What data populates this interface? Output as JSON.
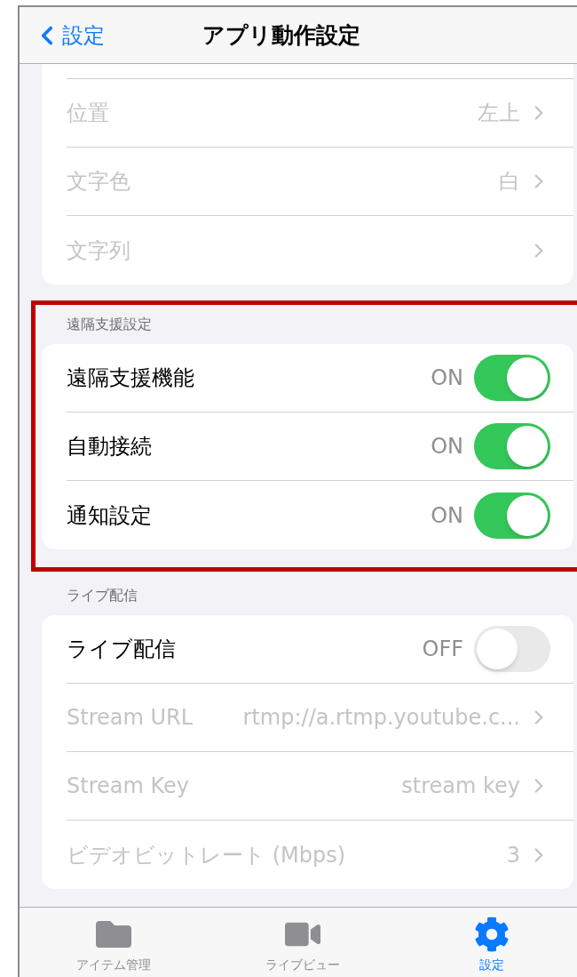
{
  "nav": {
    "back": "設定",
    "title": "アプリ動作設定"
  },
  "sections": [
    {
      "highlighted": false,
      "rows": [
        {
          "kind": "link",
          "label": "位置",
          "value": "左上",
          "disabled": true
        },
        {
          "kind": "link",
          "label": "文字色",
          "value": "白",
          "disabled": true
        },
        {
          "kind": "link",
          "label": "文字列",
          "disabled": true
        }
      ]
    },
    {
      "header": "遠隔支援設定",
      "highlighted": true,
      "rows": [
        {
          "kind": "toggle",
          "label": "遠隔支援機能",
          "value": "ON",
          "on": true,
          "disabled": false
        },
        {
          "kind": "toggle",
          "label": "自動接続",
          "value": "ON",
          "on": true,
          "disabled": false
        },
        {
          "kind": "toggle",
          "label": "通知設定",
          "value": "ON",
          "on": true,
          "disabled": false
        }
      ]
    },
    {
      "header": "ライブ配信",
      "highlighted": false,
      "rows": [
        {
          "kind": "toggle",
          "label": "ライブ配信",
          "value": "OFF",
          "on": false,
          "disabled": false
        },
        {
          "kind": "link",
          "label": "Stream URL",
          "value": "rtmp://a.rtmp.youtube.c...",
          "disabled": true
        },
        {
          "kind": "link",
          "label": "Stream Key",
          "value": "stream key",
          "disabled": true
        },
        {
          "kind": "link",
          "label": "ビデオビットレート (Mbps)",
          "value": "3",
          "disabled": true
        }
      ]
    }
  ],
  "tabs": [
    {
      "kind": "folder",
      "label": "アイテム管理",
      "selected": false
    },
    {
      "kind": "video",
      "label": "ライブビュー",
      "selected": false
    },
    {
      "kind": "gear",
      "label": "設定",
      "selected": true
    }
  ]
}
